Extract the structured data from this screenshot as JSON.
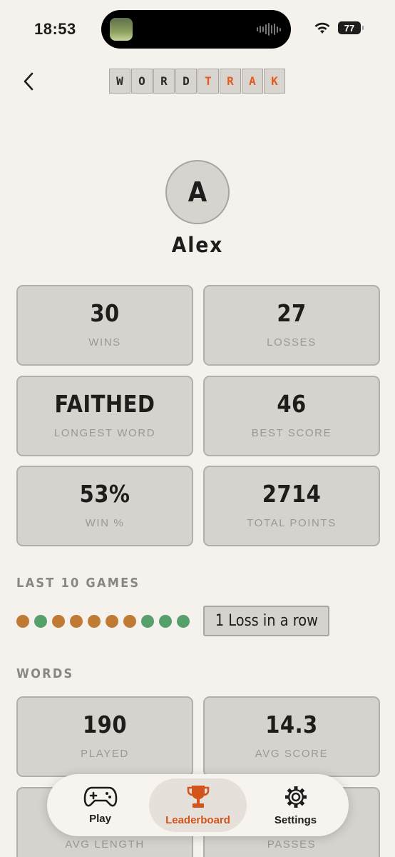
{
  "status_bar": {
    "time": "18:53",
    "battery": "77"
  },
  "header": {
    "logo_letters": [
      "W",
      "O",
      "R",
      "D",
      "T",
      "R",
      "A",
      "K"
    ]
  },
  "profile": {
    "initial": "A",
    "name": "Alex"
  },
  "stats": [
    {
      "value": "30",
      "label": "WINS"
    },
    {
      "value": "27",
      "label": "LOSSES"
    },
    {
      "value": "FAITHED",
      "label": "LONGEST WORD"
    },
    {
      "value": "46",
      "label": "BEST SCORE"
    },
    {
      "value": "53%",
      "label": "WIN %"
    },
    {
      "value": "2714",
      "label": "TOTAL POINTS"
    }
  ],
  "last_games": {
    "title": "LAST 10 GAMES",
    "results": [
      "loss",
      "win",
      "loss",
      "loss",
      "loss",
      "loss",
      "loss",
      "win",
      "win",
      "win"
    ],
    "colors": {
      "win": "#56a06b",
      "loss": "#c07a34"
    },
    "streak": "1 Loss in a row"
  },
  "words": {
    "title": "WORDS",
    "stats": [
      {
        "value": "190",
        "label": "PLAYED"
      },
      {
        "value": "14.3",
        "label": "AVG SCORE"
      },
      {
        "value": "",
        "label": "AVG LENGTH"
      },
      {
        "value": "",
        "label": "PASSES"
      }
    ]
  },
  "tabs": [
    {
      "label": "Play",
      "icon": "gamepad-icon"
    },
    {
      "label": "Leaderboard",
      "icon": "trophy-icon"
    },
    {
      "label": "Settings",
      "icon": "gear-icon"
    }
  ],
  "colors": {
    "accent": "#e45b1e",
    "background": "#f5f2ee",
    "card": "#d6d2cd"
  }
}
